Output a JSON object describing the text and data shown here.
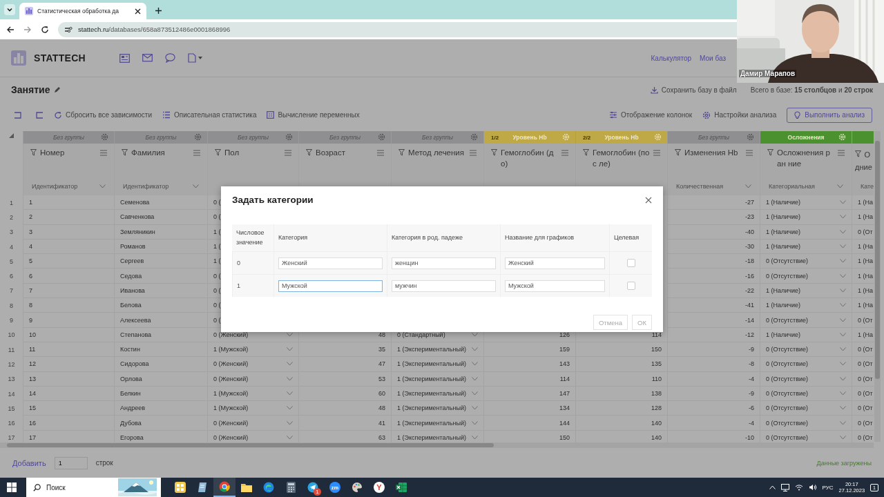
{
  "browser": {
    "tab_title": "Статистическая обработка да",
    "url_host": "stattech.ru",
    "url_path": "/databases/658a873512486e0001868996"
  },
  "app": {
    "logo": "STATTECH",
    "nav_links": [
      "Калькулятор",
      "Мои баз"
    ]
  },
  "page": {
    "title": "Занятие",
    "save_label": "Сохранить базу в файл",
    "summary": "Всего в базе: **15 столбцов** и **20 строк**"
  },
  "toolbar": {
    "left": [
      {
        "kind": "reset",
        "label": "Сбросить все зависимости"
      },
      {
        "kind": "stats",
        "label": "Описательная статистика"
      },
      {
        "kind": "calc",
        "label": "Вычисление переменных"
      }
    ],
    "right": [
      {
        "kind": "columns",
        "label": "Отображение колонок"
      },
      {
        "kind": "settings",
        "label": "Настройки анализа"
      }
    ],
    "run_button": "Выполнить анализ"
  },
  "table": {
    "columns": [
      {
        "group": {
          "label": "Без группы",
          "color": "#8f8f91"
        },
        "label": "Номер",
        "type": "Идентификатор",
        "kind": "id"
      },
      {
        "group": {
          "label": "Без группы",
          "color": "#8f8f91"
        },
        "label": "Фамилия",
        "type": "Идентификатор",
        "kind": "id"
      },
      {
        "group": {
          "label": "Без группы",
          "color": "#8f8f91"
        },
        "label": "Пол",
        "kind": "cat"
      },
      {
        "group": {
          "label": "Без группы",
          "color": "#8f8f91"
        },
        "label": "Возраст",
        "kind": "num"
      },
      {
        "group": {
          "label": "Без группы",
          "color": "#8f8f91"
        },
        "label": "Метод лечения",
        "kind": "cat"
      },
      {
        "group": {
          "label": "Уровень Hb",
          "index": "1/2",
          "color": "#bfa846"
        },
        "label": "Гемоглобин (до)",
        "kind": "num"
      },
      {
        "group": {
          "label": "Уровень Hb",
          "index": "2/2",
          "color": "#bfa846"
        },
        "label": "Гемоглобин (пос ле)",
        "kind": "num"
      },
      {
        "group": {
          "label": "Без группы",
          "color": "#8f8f91"
        },
        "label": "Изменения Hb",
        "type": "Количественная",
        "kind": "num"
      },
      {
        "group": {
          "label": "Осложнения",
          "color": "#4b9130"
        },
        "label": "Осложнения ран ние",
        "type": "Категориальная",
        "kind": "cat"
      },
      {
        "group": {
          "color": "#4b9130"
        },
        "label": "О дние",
        "type": "Кате",
        "kind": "cut"
      }
    ],
    "rows": [
      {
        "n": "1",
        "cells": [
          "1",
          "Семенова",
          "0 (",
          null,
          null,
          null,
          null,
          "-27",
          "1 (Наличие)",
          "1 (На"
        ]
      },
      {
        "n": "2",
        "cells": [
          "2",
          "Савченкова",
          "0 (",
          null,
          null,
          null,
          null,
          "-23",
          "1 (Наличие)",
          "1 (На"
        ]
      },
      {
        "n": "3",
        "cells": [
          "3",
          "Земляникин",
          "1 (",
          null,
          null,
          null,
          null,
          "-40",
          "1 (Наличие)",
          "0 (От"
        ]
      },
      {
        "n": "4",
        "cells": [
          "4",
          "Романов",
          "1 (",
          null,
          null,
          null,
          null,
          "-30",
          "1 (Наличие)",
          "1 (На"
        ]
      },
      {
        "n": "5",
        "cells": [
          "5",
          "Сергеев",
          "1 (",
          null,
          null,
          null,
          null,
          "-18",
          "0 (Отсутствие)",
          "1 (На"
        ]
      },
      {
        "n": "6",
        "cells": [
          "6",
          "Седова",
          "0 (",
          null,
          null,
          null,
          null,
          "-16",
          "0 (Отсутствие)",
          "1 (На"
        ]
      },
      {
        "n": "7",
        "cells": [
          "7",
          "Иванова",
          "0 (",
          null,
          null,
          null,
          null,
          "-22",
          "1 (Наличие)",
          "1 (На"
        ]
      },
      {
        "n": "8",
        "cells": [
          "8",
          "Белова",
          "0 (",
          null,
          null,
          null,
          null,
          "-41",
          "1 (Наличие)",
          "1 (На"
        ]
      },
      {
        "n": "9",
        "cells": [
          "9",
          "Алексеева",
          "0 (",
          null,
          null,
          null,
          null,
          "-14",
          "0 (Отсутствие)",
          "0 (От"
        ]
      },
      {
        "n": "10",
        "cells": [
          "10",
          "Степанова",
          "0 (Женский)",
          "48",
          "0 (Стандартный)",
          "126",
          "114",
          "-12",
          "1 (Наличие)",
          "1 (На"
        ]
      },
      {
        "n": "11",
        "cells": [
          "11",
          "Костин",
          "1 (Мужской)",
          "35",
          "1 (Экспериментальный)",
          "159",
          "150",
          "-9",
          "0 (Отсутствие)",
          "0 (От"
        ]
      },
      {
        "n": "12",
        "cells": [
          "12",
          "Сидорова",
          "0 (Женский)",
          "47",
          "1 (Экспериментальный)",
          "143",
          "135",
          "-8",
          "0 (Отсутствие)",
          "0 (От"
        ]
      },
      {
        "n": "13",
        "cells": [
          "13",
          "Орлова",
          "0 (Женский)",
          "53",
          "1 (Экспериментальный)",
          "114",
          "110",
          "-4",
          "0 (Отсутствие)",
          "0 (От"
        ]
      },
      {
        "n": "14",
        "cells": [
          "14",
          "Белкин",
          "1 (Мужской)",
          "60",
          "1 (Экспериментальный)",
          "147",
          "138",
          "-9",
          "0 (Отсутствие)",
          "0 (От"
        ]
      },
      {
        "n": "15",
        "cells": [
          "15",
          "Андреев",
          "1 (Мужской)",
          "48",
          "1 (Экспериментальный)",
          "134",
          "128",
          "-6",
          "0 (Отсутствие)",
          "0 (От"
        ]
      },
      {
        "n": "16",
        "cells": [
          "16",
          "Дубова",
          "0 (Женский)",
          "41",
          "1 (Экспериментальный)",
          "144",
          "140",
          "-4",
          "0 (Отсутствие)",
          "0 (От"
        ]
      },
      {
        "n": "17",
        "cells": [
          "17",
          "Егорова",
          "0 (Женский)",
          "63",
          "1 (Экспериментальный)",
          "150",
          "140",
          "-10",
          "0 (Отсутствие)",
          "0 (От"
        ]
      }
    ]
  },
  "footer": {
    "add_link": "Добавить",
    "add_count": "1",
    "rows_label": "строк",
    "status": "Данные загружены"
  },
  "modal": {
    "title": "Задать категории",
    "columns": [
      "Числовое значение",
      "Категория",
      "Категория в род. падеже",
      "Название для графиков",
      "Целевая"
    ],
    "rows": [
      {
        "value": "0",
        "category": "Женский",
        "genitive": "женщин",
        "chart_name": "Женский",
        "category_focused": false,
        "target": false
      },
      {
        "value": "1",
        "category": "Мужской",
        "genitive": "мужчин",
        "chart_name": "Мужской",
        "category_focused": true,
        "target": false
      }
    ],
    "buttons": [
      "Отмена",
      "ОК"
    ]
  },
  "webcam": {
    "name": "Дамир Марапов"
  },
  "taskbar": {
    "search": "Поиск",
    "apps": [
      {
        "kind": "widgets",
        "selected": false
      },
      {
        "kind": "notes",
        "selected": false
      },
      {
        "kind": "chrome",
        "selected": true
      },
      {
        "kind": "folder",
        "selected": false
      },
      {
        "kind": "edge",
        "selected": false
      },
      {
        "kind": "calculator",
        "selected": false
      },
      {
        "kind": "telegram",
        "selected": false,
        "badge": "1"
      },
      {
        "kind": "zoom",
        "selected": false,
        "glyph": "zm"
      },
      {
        "kind": "paint",
        "selected": false
      },
      {
        "kind": "yandex",
        "selected": false,
        "glyph": "Y"
      },
      {
        "kind": "excel",
        "selected": false
      }
    ],
    "language": "РУС",
    "time": "20:17",
    "date": "27.12.2023",
    "notifications": "1"
  }
}
